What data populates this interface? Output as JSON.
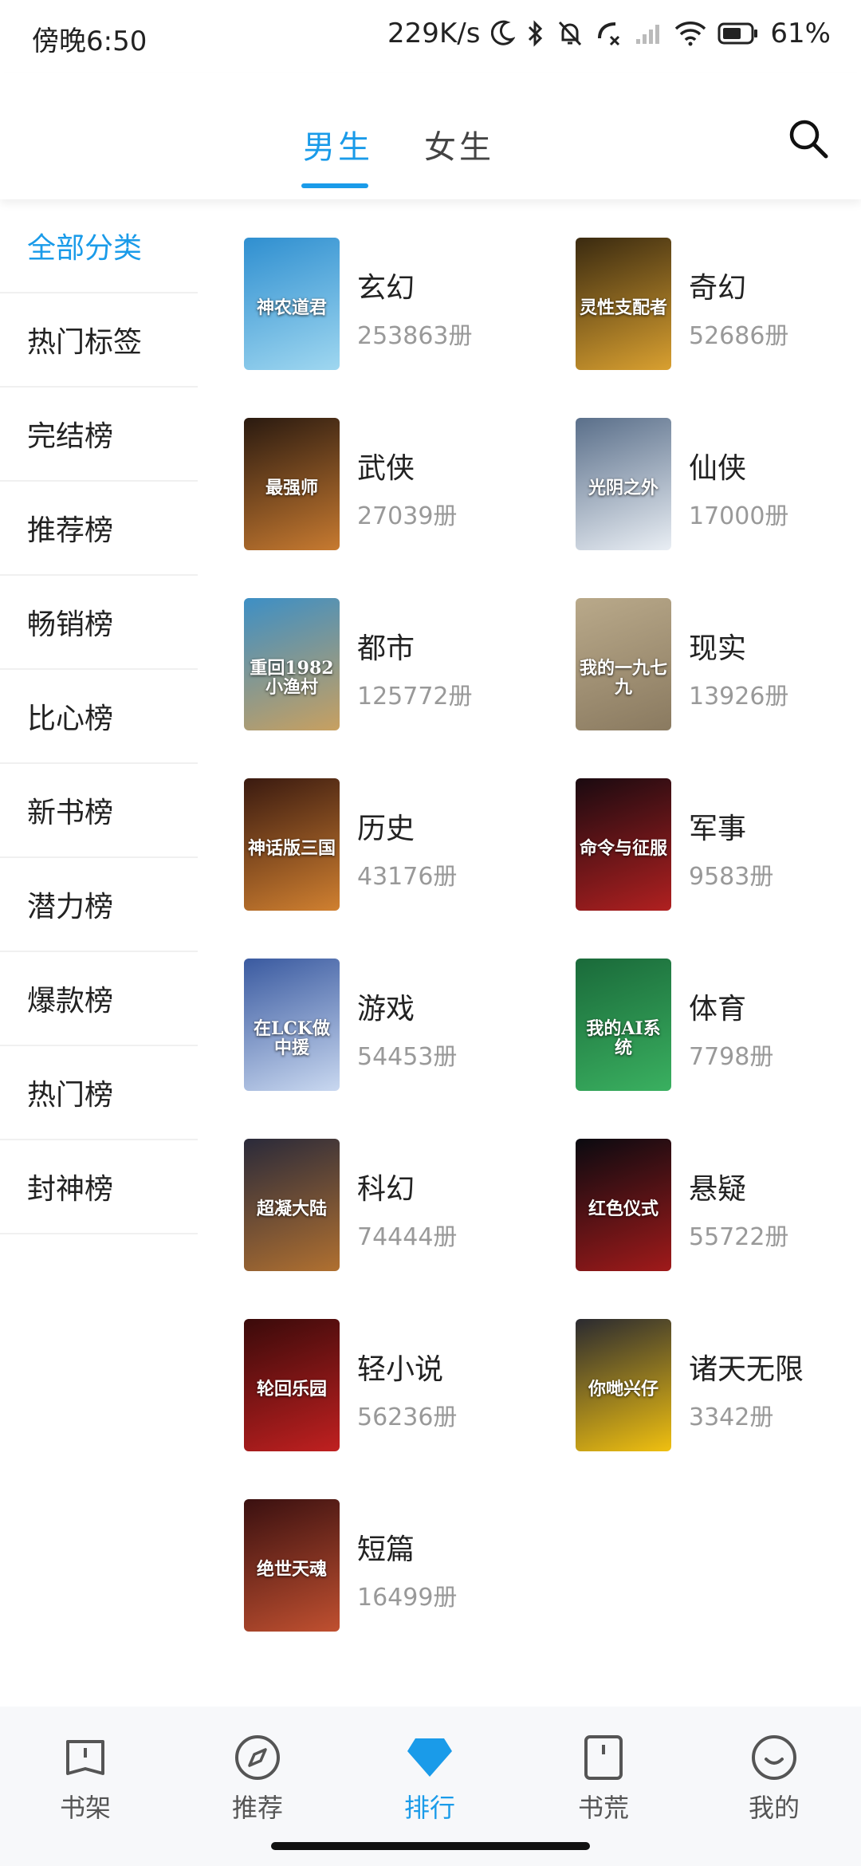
{
  "status_bar": {
    "time": "傍晚6:50",
    "net_speed": "229K/s",
    "battery": "61%"
  },
  "header": {
    "tabs": [
      {
        "label": "男生",
        "active": true
      },
      {
        "label": "女生",
        "active": false
      }
    ],
    "search_icon": "search-icon"
  },
  "categories": [
    {
      "label": "全部分类",
      "active": true
    },
    {
      "label": "热门标签"
    },
    {
      "label": "完结榜"
    },
    {
      "label": "推荐榜"
    },
    {
      "label": "畅销榜"
    },
    {
      "label": "比心榜"
    },
    {
      "label": "新书榜"
    },
    {
      "label": "潜力榜"
    },
    {
      "label": "爆款榜"
    },
    {
      "label": "热门榜"
    },
    {
      "label": "封神榜"
    }
  ],
  "genres": [
    {
      "name": "玄幻",
      "count": "253863册",
      "cover_text": "神农道君",
      "cover_colors": [
        "#2f8fd0",
        "#9fd7f0"
      ]
    },
    {
      "name": "奇幻",
      "count": "52686册",
      "cover_text": "灵性支配者",
      "cover_colors": [
        "#3a2a10",
        "#d9a030"
      ]
    },
    {
      "name": "武侠",
      "count": "27039册",
      "cover_text": "最强师",
      "cover_colors": [
        "#2a1a10",
        "#c77a30"
      ]
    },
    {
      "name": "仙侠",
      "count": "17000册",
      "cover_text": "光阴之外",
      "cover_colors": [
        "#5a6f8a",
        "#e9eef4"
      ]
    },
    {
      "name": "都市",
      "count": "125772册",
      "cover_text": "重回1982小渔村",
      "cover_colors": [
        "#3d8fc5",
        "#c8a060"
      ]
    },
    {
      "name": "现实",
      "count": "13926册",
      "cover_text": "我的一九七九",
      "cover_colors": [
        "#b9a98a",
        "#8a7a60"
      ]
    },
    {
      "name": "历史",
      "count": "43176册",
      "cover_text": "神话版三国",
      "cover_colors": [
        "#3a1a10",
        "#d08030"
      ]
    },
    {
      "name": "军事",
      "count": "9583册",
      "cover_text": "命令与征服",
      "cover_colors": [
        "#1a0a10",
        "#b02020"
      ]
    },
    {
      "name": "游戏",
      "count": "54453册",
      "cover_text": "在LCK做中援",
      "cover_colors": [
        "#3a5aa0",
        "#c9d8f0"
      ]
    },
    {
      "name": "体育",
      "count": "7798册",
      "cover_text": "我的AI系统",
      "cover_colors": [
        "#1a6a3a",
        "#3ab060"
      ]
    },
    {
      "name": "科幻",
      "count": "74444册",
      "cover_text": "超凝大陆",
      "cover_colors": [
        "#2a2a3a",
        "#b07030"
      ]
    },
    {
      "name": "悬疑",
      "count": "55722册",
      "cover_text": "红色仪式",
      "cover_colors": [
        "#0a0a10",
        "#a01a1a"
      ]
    },
    {
      "name": "轻小说",
      "count": "56236册",
      "cover_text": "轮回乐园",
      "cover_colors": [
        "#3a0a0a",
        "#c02020"
      ]
    },
    {
      "name": "诸天无限",
      "count": "3342册",
      "cover_text": "你哋兴仔",
      "cover_colors": [
        "#2a2a30",
        "#f0c010"
      ]
    },
    {
      "name": "短篇",
      "count": "16499册",
      "cover_text": "绝世天魂",
      "cover_colors": [
        "#3a1010",
        "#c05030"
      ]
    }
  ],
  "bottom_nav": [
    {
      "label": "书架",
      "icon": "bookshelf-icon",
      "active": false
    },
    {
      "label": "推荐",
      "icon": "compass-icon",
      "active": false
    },
    {
      "label": "排行",
      "icon": "diamond-icon",
      "active": true
    },
    {
      "label": "书荒",
      "icon": "book-bookmark-icon",
      "active": false
    },
    {
      "label": "我的",
      "icon": "smile-face-icon",
      "active": false
    }
  ],
  "colors": {
    "accent": "#1a9be9"
  }
}
